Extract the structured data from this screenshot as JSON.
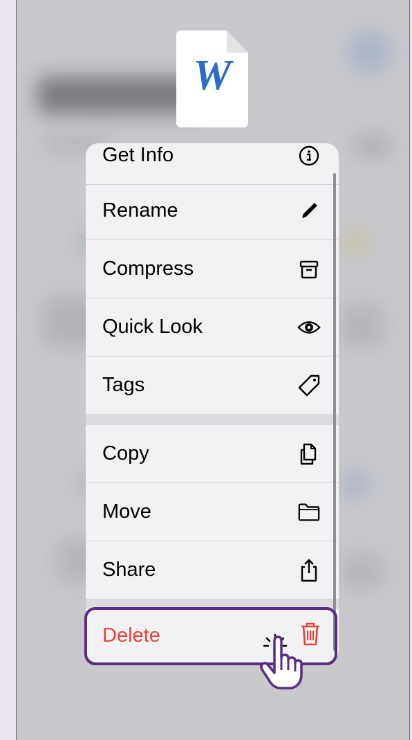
{
  "document_icon": {
    "letter": "W",
    "icon": "word-document-icon"
  },
  "menu": {
    "items": [
      {
        "label": "Get Info",
        "icon": "info-circle-icon"
      },
      {
        "label": "Rename",
        "icon": "pencil-icon"
      },
      {
        "label": "Compress",
        "icon": "archive-box-icon"
      },
      {
        "label": "Quick Look",
        "icon": "eye-icon"
      },
      {
        "label": "Tags",
        "icon": "tag-icon"
      },
      {
        "label": "Copy",
        "icon": "copy-documents-icon"
      },
      {
        "label": "Move",
        "icon": "folder-icon"
      },
      {
        "label": "Share",
        "icon": "share-icon"
      }
    ],
    "delete": {
      "label": "Delete",
      "icon": "trash-icon"
    }
  },
  "colors": {
    "destructive": "#e8443a",
    "highlight_border": "#5a2d82",
    "word_blue": "#2d6cc7"
  },
  "pointer": {
    "icon": "hand-pointer-icon"
  }
}
